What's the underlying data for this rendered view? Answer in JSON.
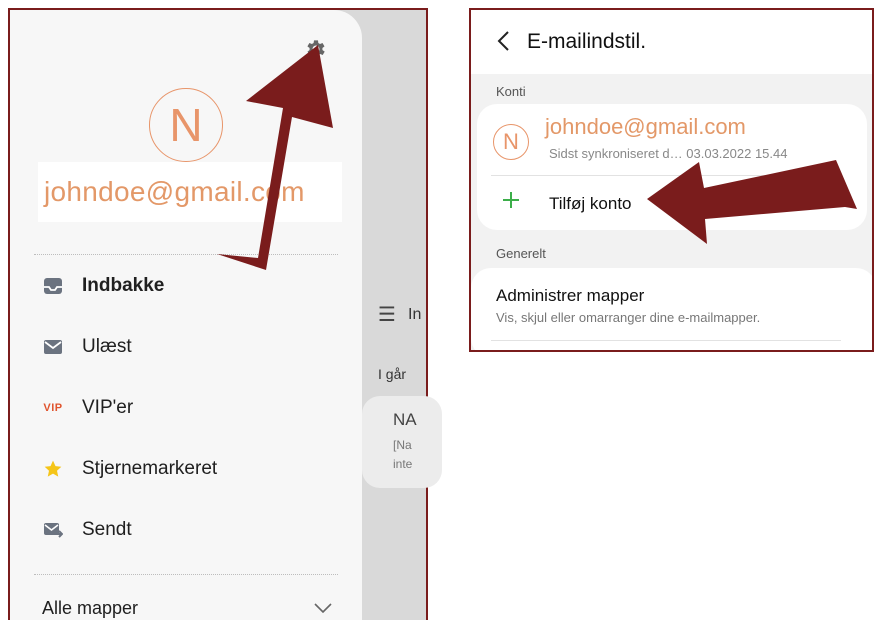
{
  "left": {
    "avatar_letter": "N",
    "account_email": "johndoe@gmail.com",
    "menu": [
      {
        "label": "Indbakke",
        "icon": "inbox-icon"
      },
      {
        "label": "Ulæst",
        "icon": "mail-icon"
      },
      {
        "label": "VIP'er",
        "icon": "vip-icon",
        "icon_text": "VIP"
      },
      {
        "label": "Stjernemarkeret",
        "icon": "star-icon"
      },
      {
        "label": "Sendt",
        "icon": "sent-icon"
      }
    ],
    "all_folders_label": "Alle mapper",
    "background": {
      "title_fragment": "In",
      "date_label": "I går",
      "card_title": "NA",
      "card_line1": "[Na",
      "card_line2": "inte"
    }
  },
  "right": {
    "title": "E-mailindstil.",
    "section_accounts": "Konti",
    "avatar_letter": "N",
    "account_email": "johndoe@gmail.com",
    "last_sync": "Sidst synkroniseret d… 03.03.2022  15.44",
    "add_account_label": "Tilføj konto",
    "section_general": "Generelt",
    "manage_folders_label": "Administrer mapper",
    "manage_folders_sub": "Vis, skjul eller omarranger dine e-mailmapper."
  },
  "colors": {
    "accent_orange": "#e39868",
    "arrow": "#7a1c1c",
    "frame": "#7a1c1c",
    "star": "#f5c518",
    "plus": "#3cae4a"
  }
}
